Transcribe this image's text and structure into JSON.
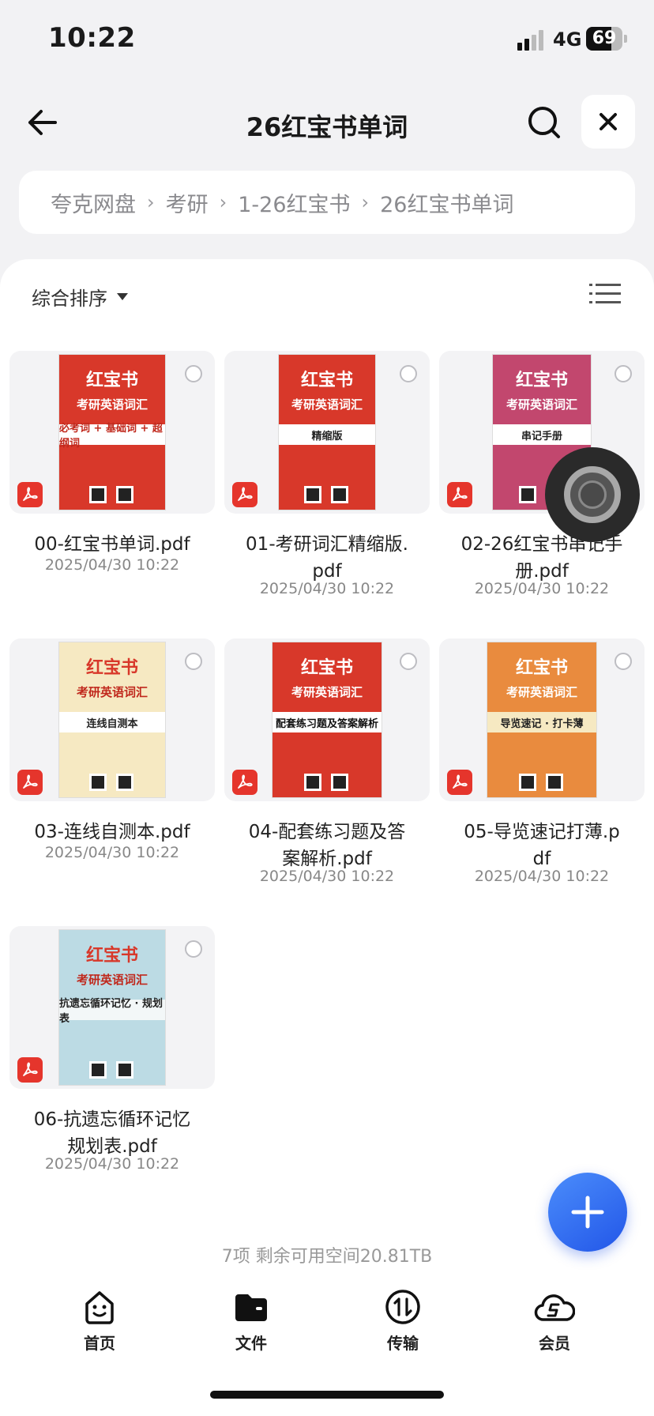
{
  "status_bar": {
    "time": "10:22",
    "network": "4G",
    "battery": "69",
    "battery_level": 0.69
  },
  "header": {
    "title": "26红宝书单词"
  },
  "breadcrumb": [
    "夸克网盘",
    "考研",
    "1-26红宝书",
    "26红宝书单词"
  ],
  "toolbar": {
    "sort_label": "综合排序"
  },
  "files": [
    {
      "name_lines": [
        "00-红宝书单词.pdf"
      ],
      "date": "2025/04/30 10:22",
      "cover_title": "红宝书",
      "cover_sub": "考研英语词汇",
      "cover_band": "必考词 + 基础词 + 超纲词"
    },
    {
      "name_lines": [
        "01-考研词汇精缩版.",
        "pdf"
      ],
      "date": "2025/04/30 10:22",
      "cover_title": "红宝书",
      "cover_sub": "考研英语词汇",
      "cover_band": "精缩版"
    },
    {
      "name_lines": [
        "02-26红宝书串记手",
        "册.pdf"
      ],
      "date": "2025/04/30 10:22",
      "cover_title": "红宝书",
      "cover_sub": "考研英语词汇",
      "cover_band": "串记手册"
    },
    {
      "name_lines": [
        "03-连线自测本.pdf"
      ],
      "date": "2025/04/30 10:22",
      "cover_title": "红宝书",
      "cover_sub": "考研英语词汇",
      "cover_band": "连线自测本"
    },
    {
      "name_lines": [
        "04-配套练习题及答",
        "案解析.pdf"
      ],
      "date": "2025/04/30 10:22",
      "cover_title": "红宝书",
      "cover_sub": "考研英语词汇",
      "cover_band": "配套练习题及答案解析"
    },
    {
      "name_lines": [
        "05-导览速记打薄.p",
        "df"
      ],
      "date": "2025/04/30 10:22",
      "cover_title": "红宝书",
      "cover_sub": "考研英语词汇",
      "cover_band": "导览速记 · 打卡薄"
    },
    {
      "name_lines": [
        "06-抗遗忘循环记忆",
        "规划表.pdf"
      ],
      "date": "2025/04/30 10:22",
      "cover_title": "红宝书",
      "cover_sub": "考研英语词汇",
      "cover_band": "抗遗忘循环记忆 · 规划表"
    }
  ],
  "footer": {
    "summary": "7项 剩余可用空间20.81TB"
  },
  "tabs": [
    {
      "label": "首页",
      "icon": "home-smile-icon"
    },
    {
      "label": "文件",
      "icon": "folder-icon"
    },
    {
      "label": "传输",
      "icon": "transfer-icon"
    },
    {
      "label": "会员",
      "icon": "vip-cloud-icon"
    }
  ],
  "colors": {
    "accent": "#2f6cf0",
    "pdf_red": "#e5352c",
    "cover_red": "#d8382a",
    "cover_pink": "#c2476e",
    "cover_orange": "#e98b3e",
    "cover_cream": "#f6e9c2",
    "cover_blue": "#bcdbe4"
  }
}
